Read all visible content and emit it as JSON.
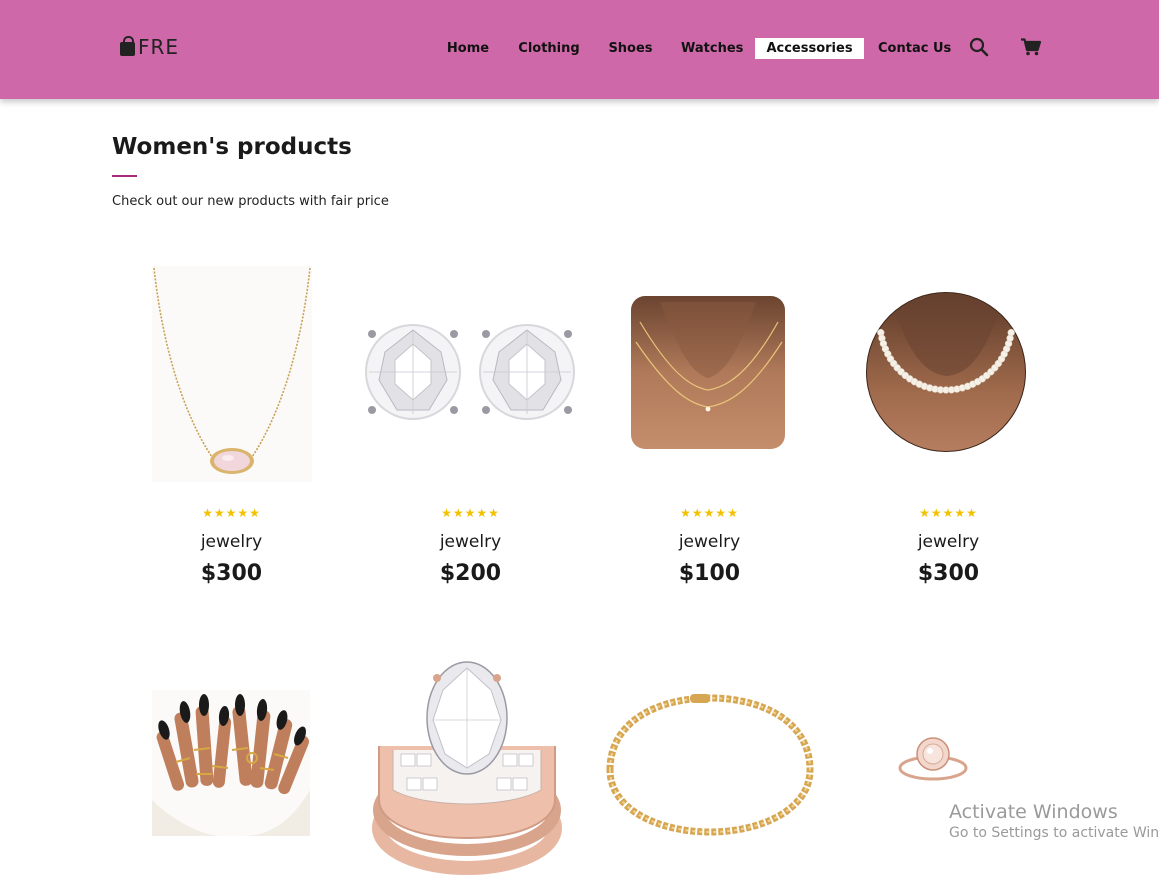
{
  "brand": {
    "name": "FRE"
  },
  "nav": {
    "items": [
      {
        "label": "Home",
        "active": false
      },
      {
        "label": "Clothing",
        "active": false
      },
      {
        "label": "Shoes",
        "active": false
      },
      {
        "label": "Watches",
        "active": false
      },
      {
        "label": "Accessories",
        "active": true
      },
      {
        "label": "Contac Us",
        "active": false
      }
    ],
    "icons": [
      "search-icon",
      "cart-icon"
    ]
  },
  "section": {
    "title": "Women's products",
    "subtitle": "Check out our new products with fair price"
  },
  "products": [
    {
      "stars": "★★★★★",
      "rating": 5,
      "name": "jewelry",
      "price": "$300",
      "image": "pendant-necklace"
    },
    {
      "stars": "★★★★★",
      "rating": 5,
      "name": "jewelry",
      "price": "$200",
      "image": "diamond-stud-earrings"
    },
    {
      "stars": "★★★★★",
      "rating": 5,
      "name": "jewelry",
      "price": "$100",
      "image": "layered-gold-necklace"
    },
    {
      "stars": "★★★★★",
      "rating": 5,
      "name": "jewelry",
      "price": "$300",
      "image": "pearl-necklace"
    }
  ],
  "products_row2": [
    {
      "image": "gold-rings-hands"
    },
    {
      "image": "rose-gold-diamond-ring"
    },
    {
      "image": "gold-chain-bracelet"
    },
    {
      "image": "rose-gold-halo-ring"
    }
  ],
  "colors": {
    "header": "#cf68a8",
    "accent": "#a82a7a",
    "star": "#f2c200"
  },
  "watermark": {
    "title": "Activate Windows",
    "subtitle": "Go to Settings to activate Windows."
  }
}
